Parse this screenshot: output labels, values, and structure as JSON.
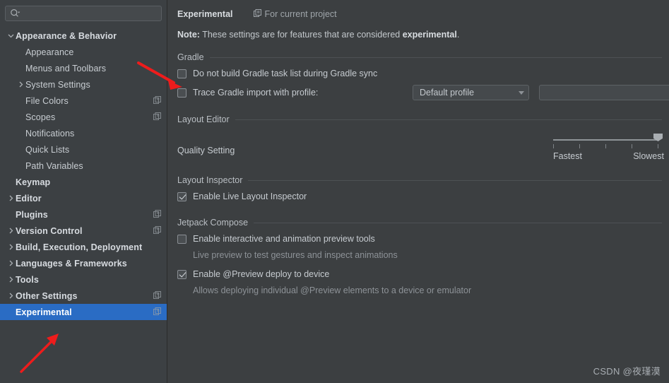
{
  "colors": {
    "accent_selected": "#2a6cc4",
    "sidebar_bg": "#3c4043",
    "content_bg": "#3c3f41",
    "arrow_red": "#ee1c1c",
    "text": "#c6cbd0",
    "muted_text": "#8d9297"
  },
  "sidebar": {
    "search": {
      "value": "",
      "placeholder": ""
    },
    "items": [
      {
        "label": "Appearance & Behavior",
        "twisty": "v",
        "bold": true,
        "indent": 0,
        "scope_icon": false,
        "selected": false
      },
      {
        "label": "Appearance",
        "twisty": "",
        "bold": false,
        "indent": 1,
        "scope_icon": false,
        "selected": false
      },
      {
        "label": "Menus and Toolbars",
        "twisty": "",
        "bold": false,
        "indent": 1,
        "scope_icon": false,
        "selected": false
      },
      {
        "label": "System Settings",
        "twisty": ">",
        "bold": false,
        "indent": 1,
        "scope_icon": false,
        "selected": false
      },
      {
        "label": "File Colors",
        "twisty": "",
        "bold": false,
        "indent": 1,
        "scope_icon": true,
        "selected": false
      },
      {
        "label": "Scopes",
        "twisty": "",
        "bold": false,
        "indent": 1,
        "scope_icon": true,
        "selected": false
      },
      {
        "label": "Notifications",
        "twisty": "",
        "bold": false,
        "indent": 1,
        "scope_icon": false,
        "selected": false
      },
      {
        "label": "Quick Lists",
        "twisty": "",
        "bold": false,
        "indent": 1,
        "scope_icon": false,
        "selected": false
      },
      {
        "label": "Path Variables",
        "twisty": "",
        "bold": false,
        "indent": 1,
        "scope_icon": false,
        "selected": false
      },
      {
        "label": "Keymap",
        "twisty": "",
        "bold": true,
        "indent": 0,
        "scope_icon": false,
        "selected": false
      },
      {
        "label": "Editor",
        "twisty": ">",
        "bold": true,
        "indent": 0,
        "scope_icon": false,
        "selected": false
      },
      {
        "label": "Plugins",
        "twisty": "",
        "bold": true,
        "indent": 0,
        "scope_icon": true,
        "selected": false
      },
      {
        "label": "Version Control",
        "twisty": ">",
        "bold": true,
        "indent": 0,
        "scope_icon": true,
        "selected": false
      },
      {
        "label": "Build, Execution, Deployment",
        "twisty": ">",
        "bold": true,
        "indent": 0,
        "scope_icon": false,
        "selected": false
      },
      {
        "label": "Languages & Frameworks",
        "twisty": ">",
        "bold": true,
        "indent": 0,
        "scope_icon": false,
        "selected": false
      },
      {
        "label": "Tools",
        "twisty": ">",
        "bold": true,
        "indent": 0,
        "scope_icon": false,
        "selected": false
      },
      {
        "label": "Other Settings",
        "twisty": ">",
        "bold": true,
        "indent": 0,
        "scope_icon": true,
        "selected": false
      },
      {
        "label": "Experimental",
        "twisty": "",
        "bold": true,
        "indent": 0,
        "scope_icon": true,
        "selected": true
      }
    ]
  },
  "header": {
    "title": "Experimental",
    "scope_label": "For current project"
  },
  "note": {
    "prefix": "Note:",
    "body": " These settings are for features that are considered ",
    "emphasis": "experimental",
    "suffix": "."
  },
  "gradle": {
    "group_title": "Gradle",
    "no_task_list": {
      "label": "Do not build Gradle task list during Gradle sync",
      "checked": false
    },
    "trace": {
      "label": "Trace Gradle import with profile:",
      "checked": false,
      "profile_value": "Default profile",
      "profile_options": [
        "Default profile"
      ],
      "path_value": "",
      "browse_icon": "folder-icon"
    }
  },
  "layout_editor": {
    "group_title": "Layout Editor",
    "quality_label": "Quality Setting",
    "slider": {
      "min_label": "Fastest",
      "max_label": "Slowest",
      "ticks": 5,
      "value": 4,
      "max": 4
    }
  },
  "layout_inspector": {
    "group_title": "Layout Inspector",
    "enable_live": {
      "label": "Enable Live Layout Inspector",
      "checked": true
    }
  },
  "jetpack_compose": {
    "group_title": "Jetpack Compose",
    "interactive_preview": {
      "label": "Enable interactive and animation preview tools",
      "checked": false,
      "sub_label": "Live preview to test gestures and inspect animations"
    },
    "preview_deploy": {
      "label": "Enable @Preview deploy to device",
      "checked": true,
      "sub_label": "Allows deploying individual @Preview elements to a device or emulator"
    }
  },
  "watermark": {
    "text": "CSDN @夜瑾漠"
  }
}
